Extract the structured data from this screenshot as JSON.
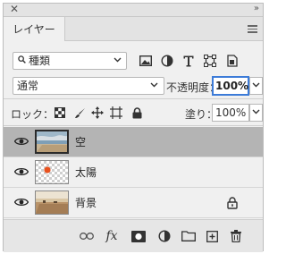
{
  "panel": {
    "close_glyph": "✕",
    "collapse_glyph": "»",
    "tab_label": "レイヤー"
  },
  "filter": {
    "selected": "種類",
    "icons": [
      "pixel-filter-icon",
      "adjustment-filter-icon",
      "type-filter-icon",
      "shape-filter-icon",
      "smart-object-filter-icon"
    ]
  },
  "blend": {
    "mode": "通常",
    "opacity_label": "不透明度：",
    "opacity_value": "100%"
  },
  "lock": {
    "label": "ロック：",
    "fill_label": "塗り：",
    "fill_value": "100%"
  },
  "layers": [
    {
      "name": "空",
      "visible": true,
      "selected": true,
      "locked": false
    },
    {
      "name": "太陽",
      "visible": true,
      "selected": false,
      "locked": false
    },
    {
      "name": "背景",
      "visible": true,
      "selected": false,
      "locked": true
    }
  ],
  "bottom_toolbar": {
    "fx_label": "fx",
    "icons": [
      "link-icon",
      "fx-icon",
      "mask-icon",
      "adjustment-icon",
      "folder-icon",
      "new-layer-icon",
      "trash-icon"
    ]
  },
  "colors": {
    "accent": "#3c7bd8",
    "selected_row": "#b4b4b4",
    "sun": "#e8521f"
  }
}
